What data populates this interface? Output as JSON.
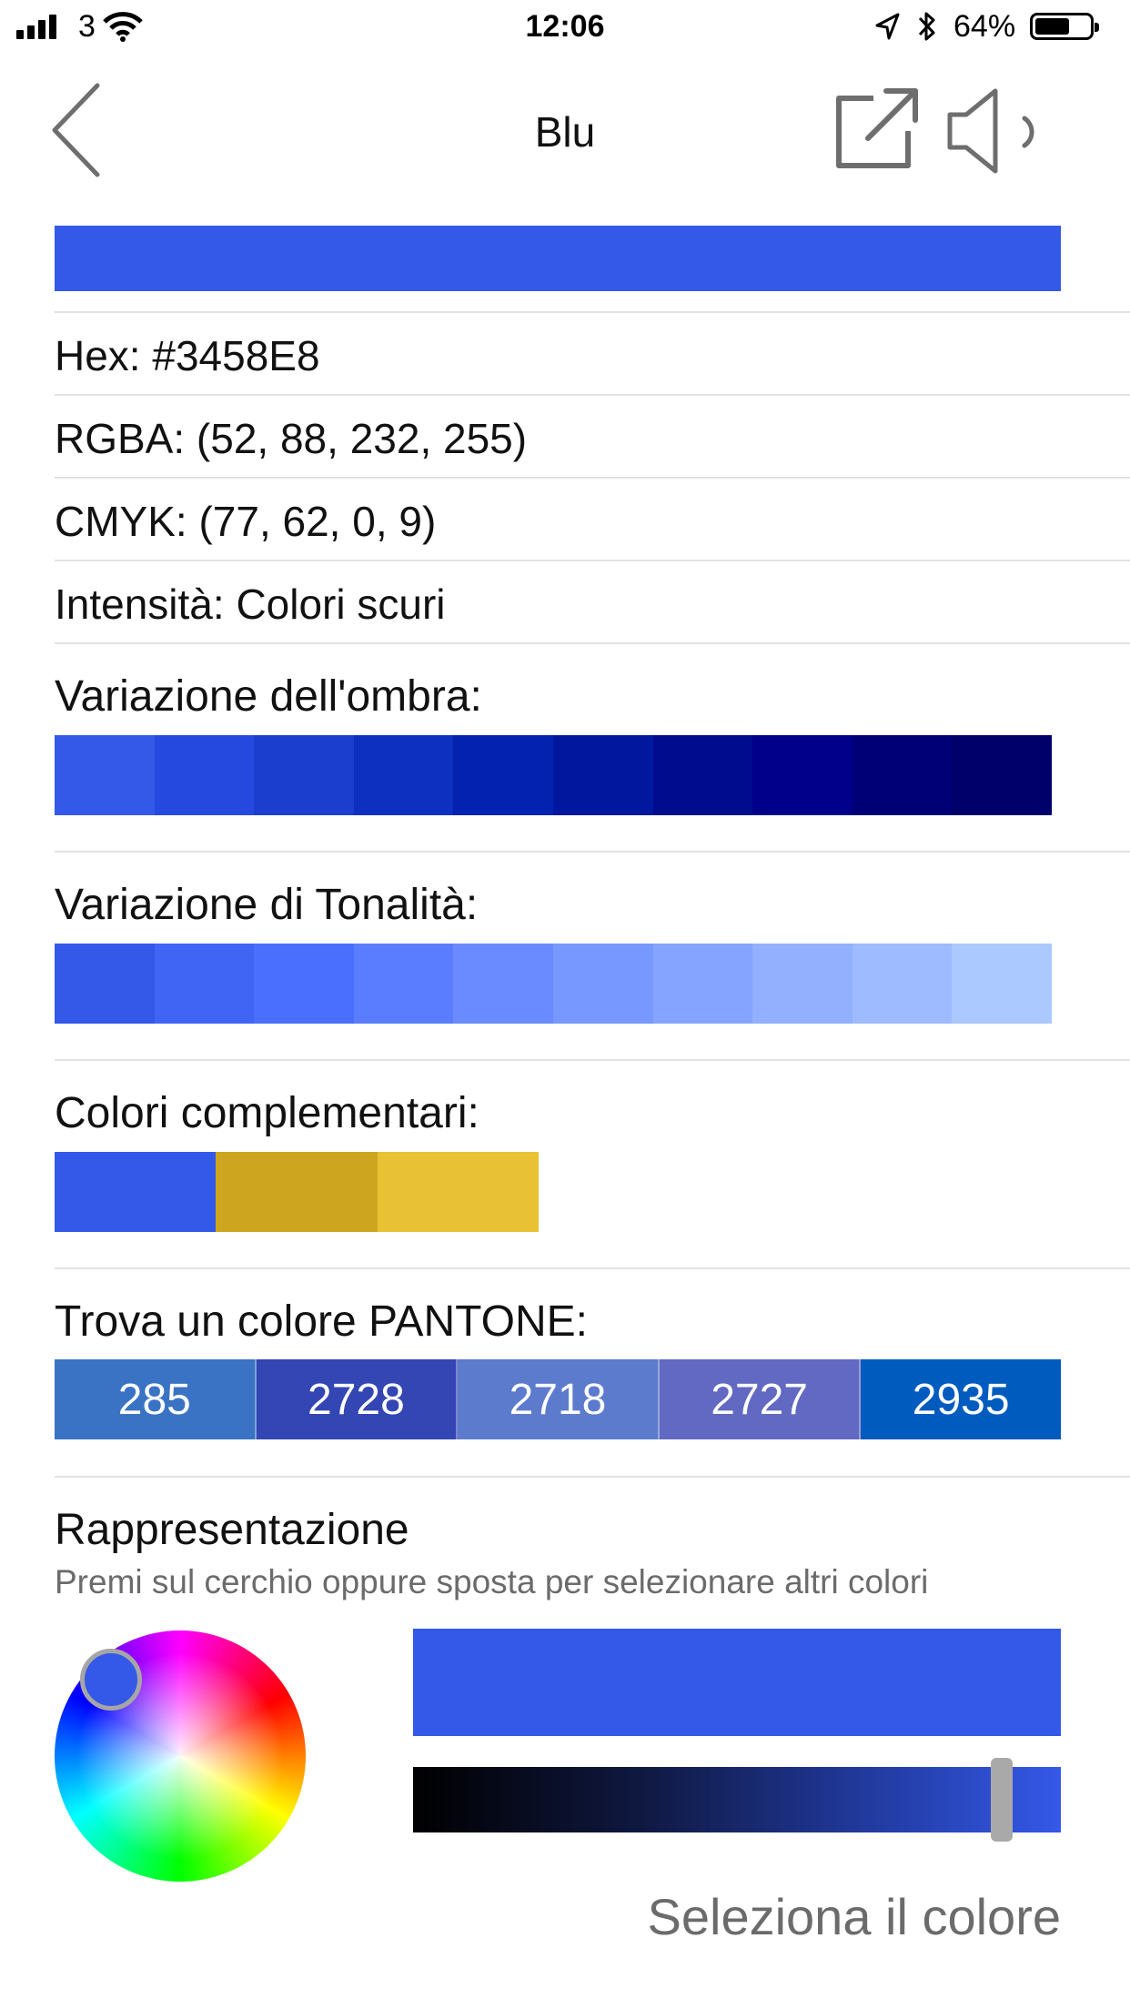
{
  "status_bar": {
    "carrier": "3",
    "time": "12:06",
    "battery_percent": "64%",
    "battery_level": 0.64,
    "icons": [
      "signal-icon",
      "wifi-icon",
      "location-icon",
      "bluetooth-icon",
      "battery-icon"
    ]
  },
  "nav": {
    "title": "Blu",
    "back_icon": "chevron-left-icon",
    "share_icon": "share-icon",
    "speaker_icon": "speaker-icon"
  },
  "color": {
    "hex": "#3458E8",
    "info": {
      "hex_line": "Hex: #3458E8",
      "rgba_line": "RGBA: (52, 88, 232, 255)",
      "cmyk_line": "CMYK: (77, 62, 0, 9)",
      "intensity_line": "Intensità: Colori scuri"
    }
  },
  "shades": {
    "title": "Variazione dell'ombra:",
    "colors": [
      "#3458E8",
      "#2549DF",
      "#1B3ECF",
      "#0E30C0",
      "#0322B0",
      "#00179E",
      "#000C8E",
      "#00008A",
      "#000076",
      "#00006A"
    ]
  },
  "tints": {
    "title": "Variazione di Tonalità:",
    "colors": [
      "#3458E8",
      "#4064F4",
      "#4A6FFF",
      "#5A7DFF",
      "#6A8BFF",
      "#7798FF",
      "#84A4FF",
      "#92B0FF",
      "#9FBBFF",
      "#ABC8FF"
    ]
  },
  "complementary": {
    "title": "Colori complementari:",
    "colors": [
      "#3458E8",
      "#CDA51E",
      "#E8C234"
    ]
  },
  "pantone": {
    "title": "Trova un colore PANTONE:",
    "items": [
      {
        "label": "285",
        "color": "#3A73C4"
      },
      {
        "label": "2728",
        "color": "#3346B3"
      },
      {
        "label": "2718",
        "color": "#5D7BCC"
      },
      {
        "label": "2727",
        "color": "#6169C2"
      },
      {
        "label": "2935",
        "color": "#005BBF"
      }
    ]
  },
  "representation": {
    "title": "Rappresentazione",
    "hint": "Premi sul cerchio oppure sposta per selezionare altri colori",
    "preview_color": "#3458E8",
    "brightness_value": 0.91,
    "select_label": "Seleziona il colore"
  }
}
